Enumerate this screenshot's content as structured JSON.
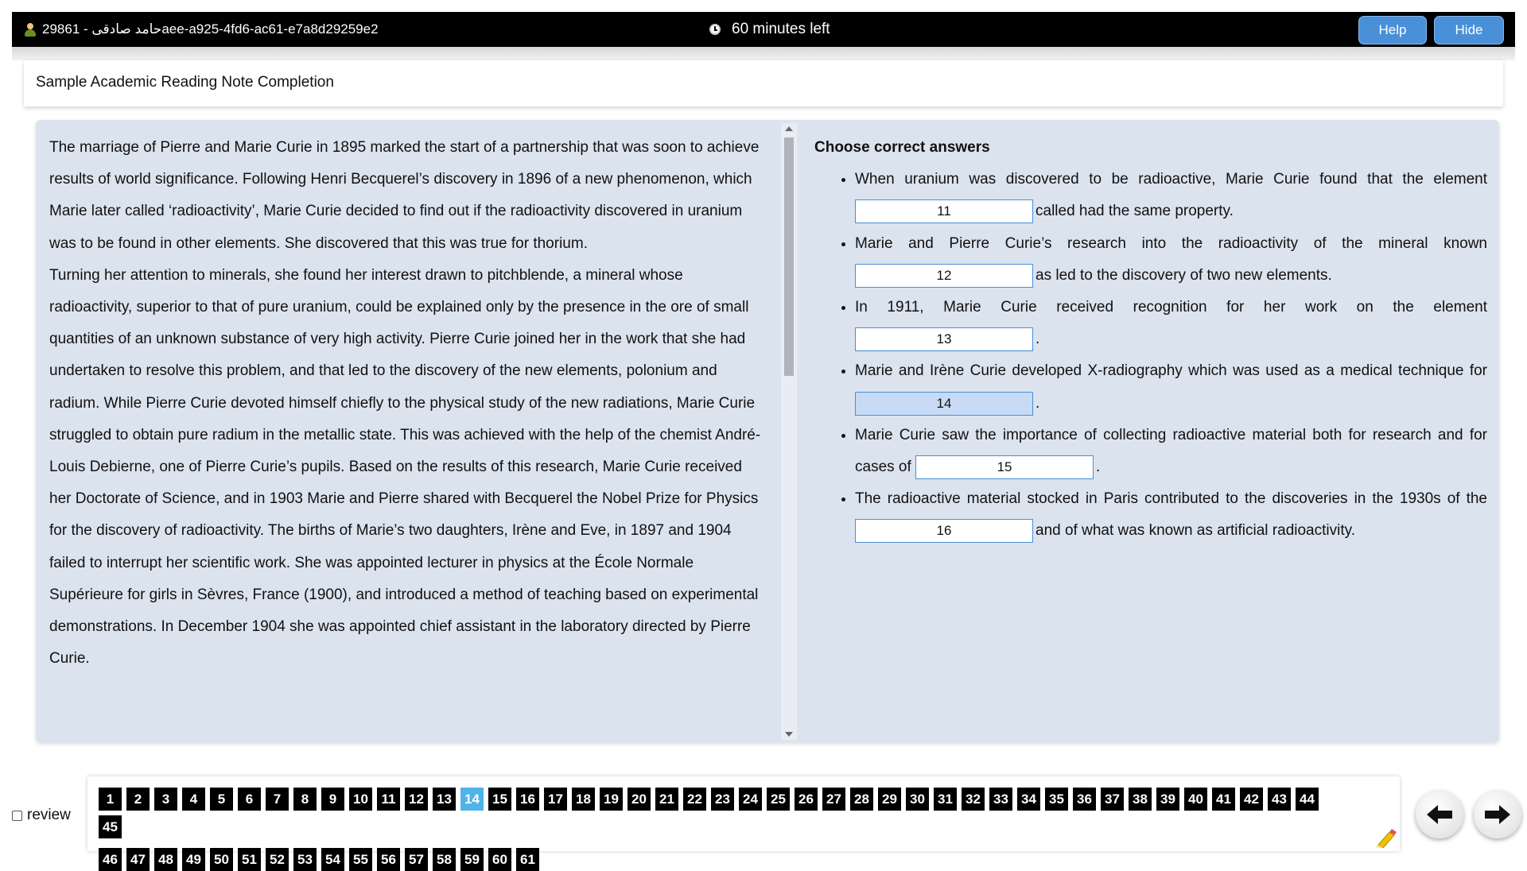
{
  "header": {
    "candidate": "29861 - حامد صادقیaee-a925-4fd6-ac61-e7a8d29259e2",
    "timer": "60 minutes left",
    "help_label": "Help",
    "hide_label": "Hide"
  },
  "title": "Sample Academic Reading Note Completion",
  "passage": {
    "paragraphs": [
      "The marriage of Pierre and Marie Curie in 1895 marked the start of a partnership that was soon to achieve results of world significance. Following Henri Becquerel’s discovery in 1896 of a new phenomenon, which Marie later called ‘radioactivity’, Marie Curie decided to find out if the radioactivity discovered in uranium was to be found in other elements. She discovered that this was true for thorium.",
      "Turning her attention to minerals, she found her interest drawn to pitchblende, a mineral whose radioactivity, superior to that of pure uranium, could be explained only by the presence in the ore of small quantities of an unknown substance of very high activity. Pierre Curie joined her in the work that she had undertaken to resolve this problem, and that led to the discovery of the new elements, polonium and radium. While Pierre Curie devoted himself chiefly to the physical study of the new radiations, Marie Curie struggled to obtain pure radium in the metallic state. This was achieved with the help of the chemist André-Louis Debierne, one of Pierre Curie’s pupils. Based on the results of this research, Marie Curie received her Doctorate of Science, and in 1903 Marie and Pierre shared with Becquerel the Nobel Prize for Physics for the discovery of radioactivity. The births of Marie’s two daughters, Irène and Eve, in 1897 and 1904 failed to interrupt her scientific work. She was appointed lecturer in physics at the École Normale Supérieure for girls in Sèvres, France (1900), and introduced a method of teaching based on experimental demonstrations. In December 1904 she was appointed chief assistant in the laboratory directed by Pierre Curie."
    ]
  },
  "questions": {
    "heading": "Choose correct answers",
    "items": [
      {
        "before": "When uranium was discovered to be radioactive, Marie Curie found that the element",
        "box": "11",
        "after": "called had the same property."
      },
      {
        "before": "Marie and Pierre Curie’s research into the radioactivity of the mineral known",
        "box": "12",
        "after": "as led to the discovery of two new elements."
      },
      {
        "before": "In 1911, Marie Curie received recognition for her work on the element",
        "box": "13",
        "after": "."
      },
      {
        "before": "Marie and Irène Curie developed X-radiography which was used as a medical technique for",
        "box": "14",
        "after": "."
      },
      {
        "before": "Marie Curie saw the importance of collecting radioactive material both for research and for cases of",
        "box": "15",
        "after": "."
      },
      {
        "before": "The radioactive material stocked in Paris contributed to the discoveries in the 1930s of the",
        "box": "16",
        "after": "and of what was known as artificial radioactivity."
      }
    ]
  },
  "nav": {
    "review_label": "review",
    "current_question": 14,
    "question_numbers": [
      "1",
      "2",
      "3",
      "4",
      "5",
      "6",
      "7",
      "8",
      "9",
      "10",
      "11",
      "12",
      "13",
      "14",
      "15",
      "16",
      "17",
      "18",
      "19",
      "20",
      "21",
      "22",
      "23",
      "24",
      "25",
      "26",
      "27",
      "28",
      "29",
      "30",
      "31",
      "32",
      "33",
      "34",
      "35",
      "36",
      "37",
      "38",
      "39",
      "40",
      "41",
      "42",
      "43",
      "44",
      "45",
      "46",
      "47",
      "48",
      "49",
      "50",
      "51",
      "52",
      "53",
      "54",
      "55",
      "56",
      "57",
      "58",
      "59",
      "60",
      "61"
    ]
  },
  "colors": {
    "topbar": "#000000",
    "button": "#4a90d9",
    "panel": "#dbe3ef",
    "current_question": "#4fb3e8",
    "answer_border": "#4a8ed6"
  }
}
